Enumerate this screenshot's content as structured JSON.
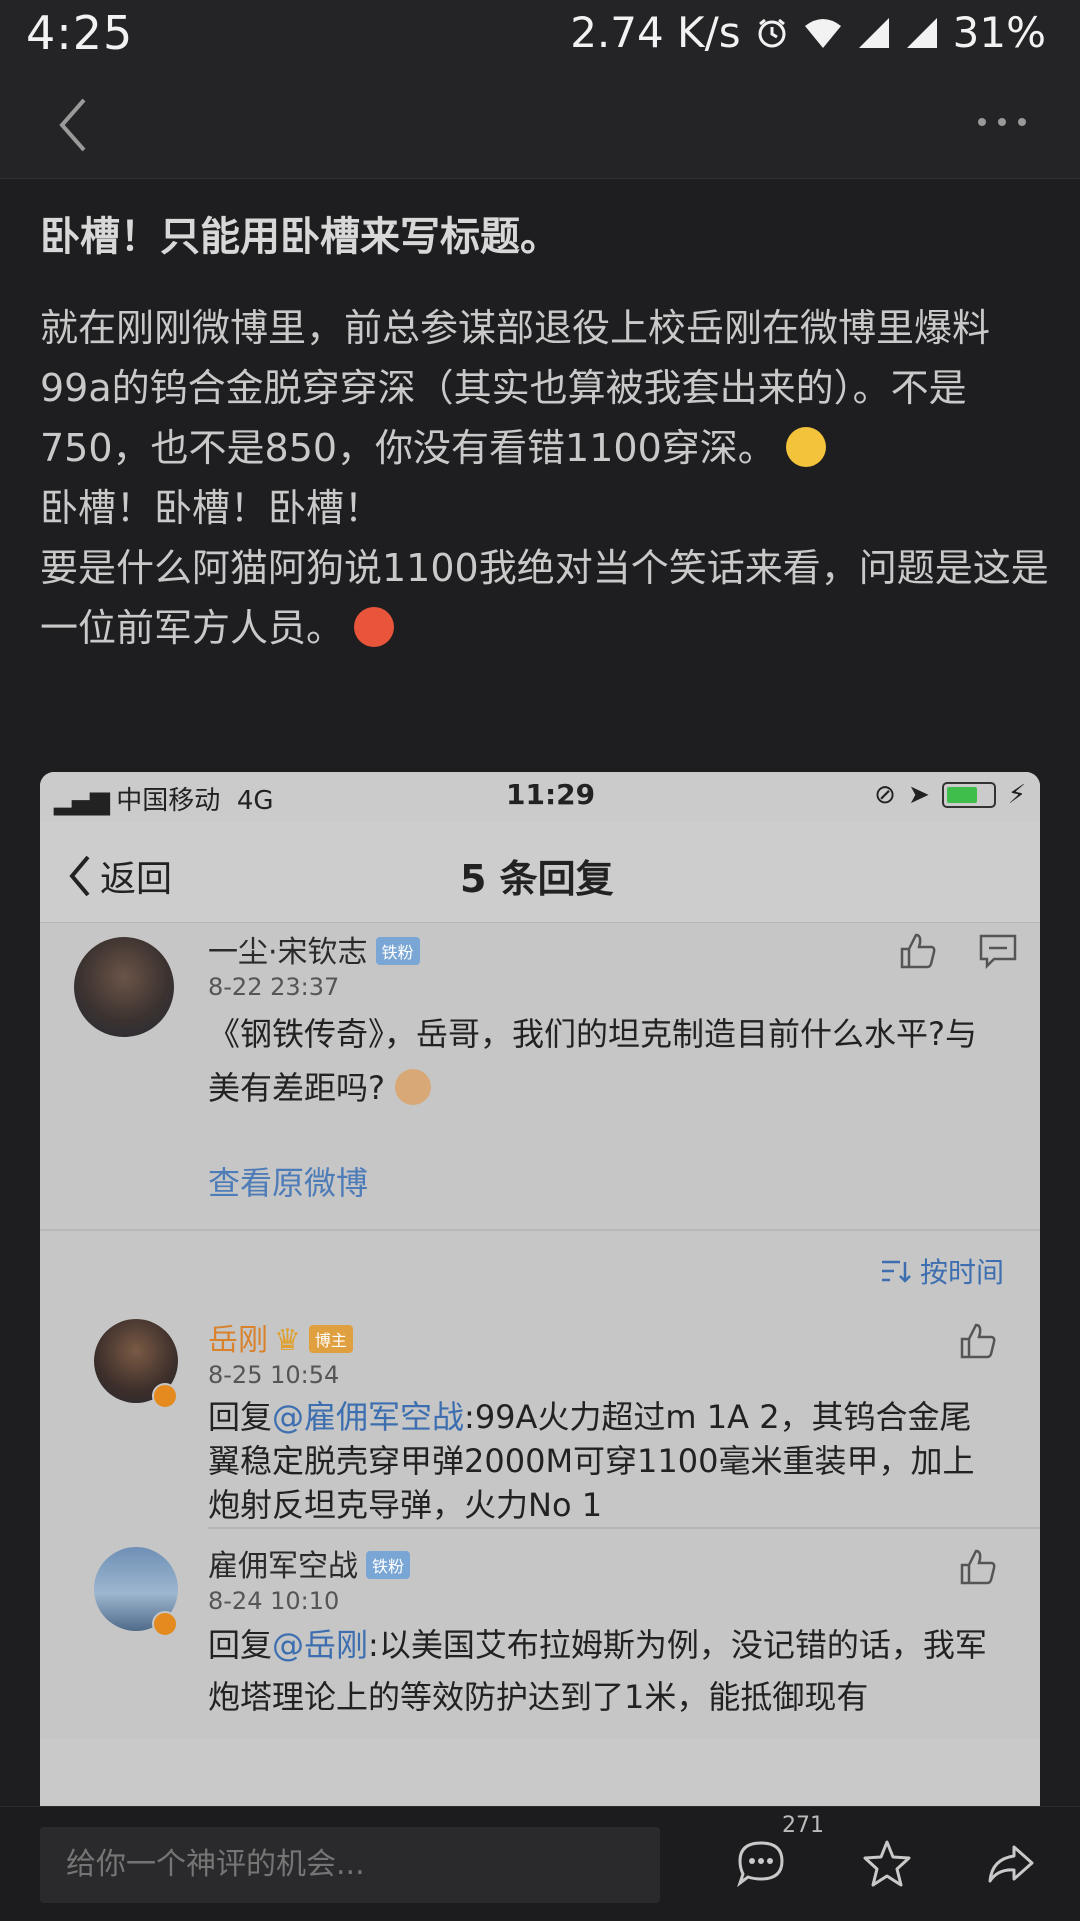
{
  "status_bar": {
    "time": "4:25",
    "speed": "2.74 K/s",
    "battery": "31%"
  },
  "article": {
    "title": "卧槽！只能用卧槽来写标题。",
    "p1": "就在刚刚微博里，前总参谋部退役上校岳刚在微博里爆料99a的钨合金脱穿穿深（其实也算被我套出来的）。不是750，也不是850，你没有看错1100穿深。",
    "p2": "卧槽！卧槽！卧槽！",
    "p3": "要是什么阿猫阿狗说1100我绝对当个笑话来看，问题是这是一位前军方人员。"
  },
  "screenshot": {
    "status": {
      "carrier": "中国移动",
      "network": "4G",
      "time": "11:29"
    },
    "nav": {
      "back": "返回",
      "title": "5 条回复"
    },
    "original": {
      "name": "一尘·宋钦志",
      "badge": "铁粉",
      "time": "8-22 23:37",
      "text": "《钢铁传奇》，岳哥，我们的坦克制造目前什么水平?与美有差距吗?",
      "view": "查看原微博"
    },
    "sort": "按时间",
    "replies": [
      {
        "name": "岳刚",
        "badge": "博主",
        "time": "8-25 10:54",
        "prefix": "回复",
        "mention": "@雇佣军空战",
        "text": ":99A火力超过m 1A 2，其钨合金尾翼稳定脱壳穿甲弹2000M可穿1100毫米重装甲，加上炮射反坦克导弹，火力No 1"
      },
      {
        "name": "雇佣军空战",
        "badge": "铁粉",
        "time": "8-24 10:10",
        "prefix": "回复",
        "mention": "@岳刚",
        "text": ":以美国艾布拉姆斯为例，没记错的话，我军炮塔理论上的等效防护达到了1米，能抵御现有"
      }
    ]
  },
  "bottom": {
    "placeholder": "给你一个神评的机会...",
    "comment_count": "271"
  },
  "colors": {
    "background": "#1e1e20",
    "link": "#3d6fb0",
    "host_name": "#d9822b"
  }
}
